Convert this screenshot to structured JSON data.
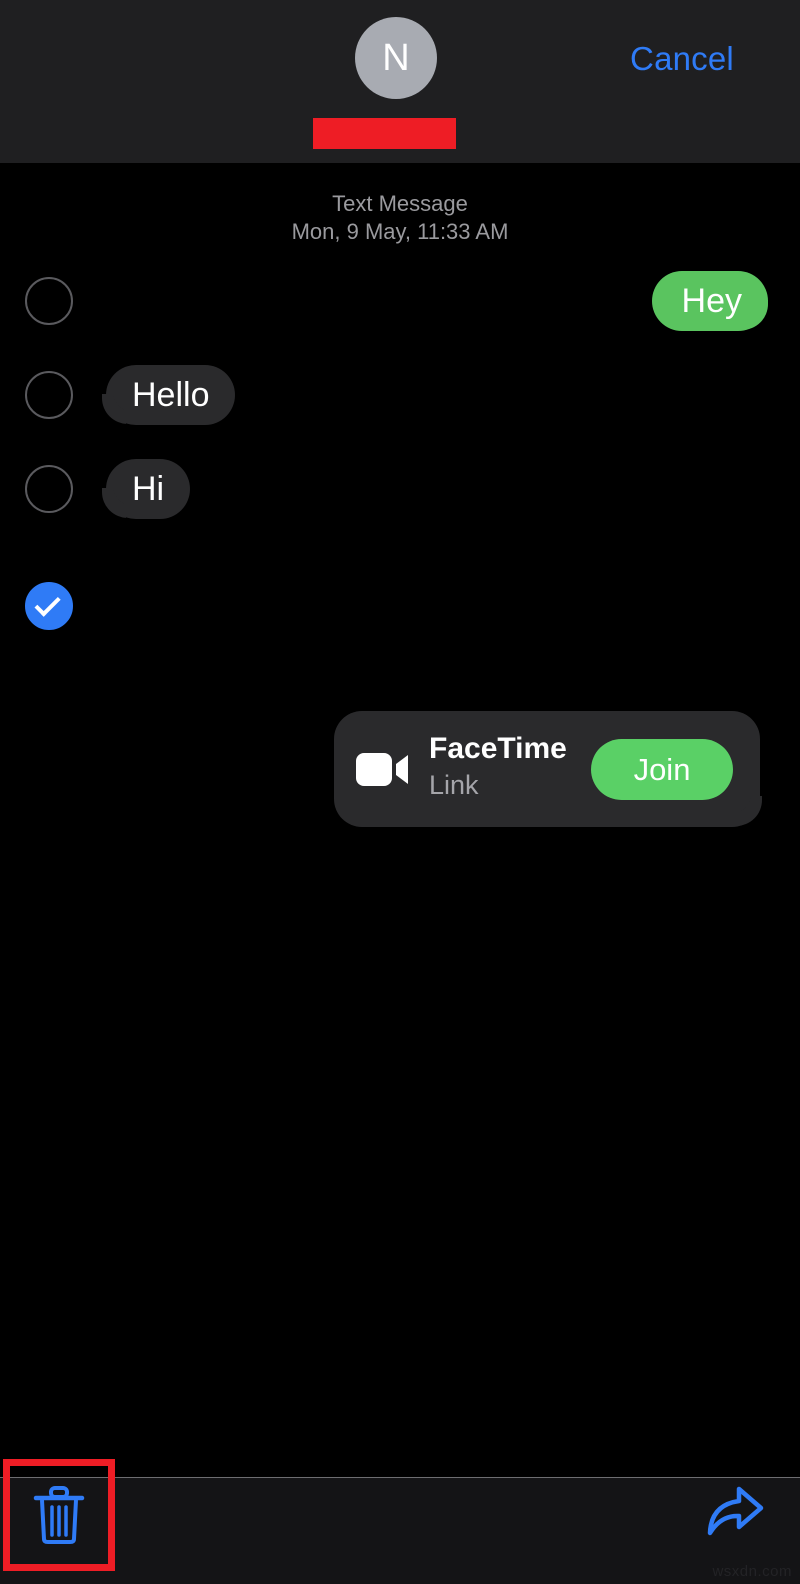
{
  "header": {
    "avatar_initial": "N",
    "avatar_color": "#a8abb2",
    "redaction_color": "#ee1d25",
    "cancel_label": "Cancel",
    "accent_color": "#2f7bf6"
  },
  "conversation": {
    "timestamp_label": "Text Message",
    "timestamp_datetime": "Mon, 9 May, 11:33 AM",
    "messages": [
      {
        "text": "Hey",
        "direction": "outgoing",
        "selected": false,
        "bubble_color": "#5ac45f"
      },
      {
        "text": "Hello",
        "direction": "incoming",
        "selected": false,
        "bubble_color": "#2a2a2c"
      },
      {
        "text": "Hi",
        "direction": "incoming",
        "selected": false,
        "bubble_color": "#2a2a2c"
      }
    ],
    "facetime": {
      "title": "FaceTime",
      "subtitle": "Link",
      "join_label": "Join",
      "join_color": "#5ad066",
      "selected": true,
      "direction": "outgoing"
    }
  },
  "toolbar": {
    "delete_icon": "trash-icon",
    "forward_icon": "forward-arrow-icon",
    "icon_color": "#2f7bf6",
    "highlight_color": "#ee1d25"
  },
  "watermark": "wsxdn.com"
}
